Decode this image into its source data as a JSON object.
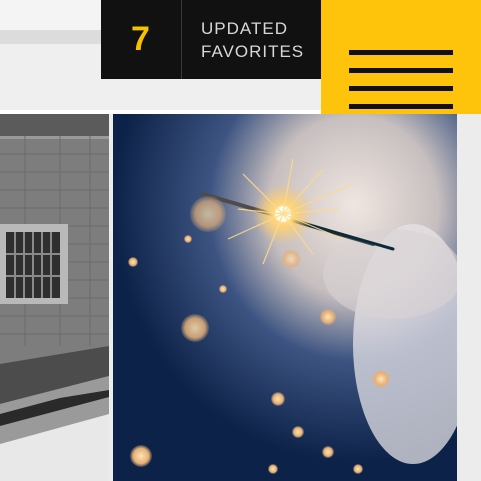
{
  "header": {
    "counter_value": "7",
    "counter_label": "UPDATED\nFAVORITES",
    "menu_icon": "hamburger-menu-icon"
  },
  "colors": {
    "accent": "#fec40b",
    "counter_bg": "#111111",
    "counter_number": "#f5c200"
  },
  "gallery": {
    "items": [
      {
        "icon": "photo-building-bw"
      },
      {
        "icon": "photo-sparkler"
      }
    ]
  }
}
